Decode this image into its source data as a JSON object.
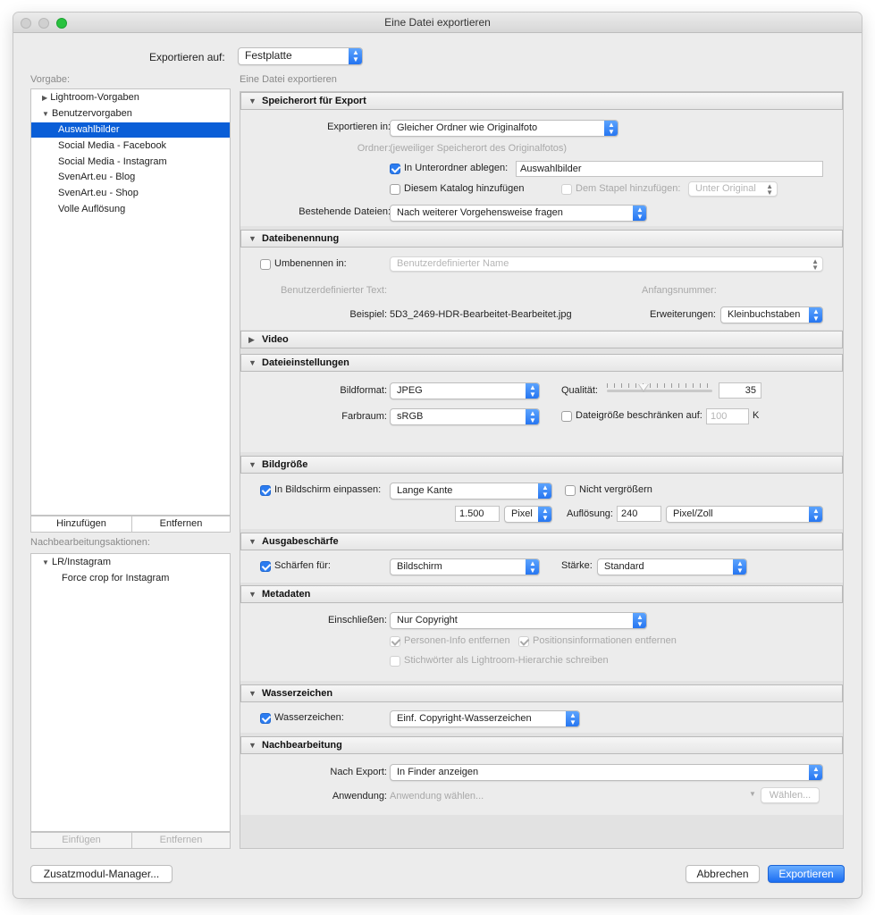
{
  "window": {
    "title": "Eine Datei exportieren"
  },
  "export_to": {
    "label": "Exportieren auf:",
    "value": "Festplatte"
  },
  "sidebar": {
    "presets_label": "Vorgabe:",
    "groups": [
      {
        "label": "Lightroom-Vorgaben",
        "expanded": false
      },
      {
        "label": "Benutzervorgaben",
        "expanded": true
      }
    ],
    "items": [
      "Auswahlbilder",
      "Social Media - Facebook",
      "Social Media - Instagram",
      "SvenArt.eu - Blog",
      "SvenArt.eu - Shop",
      "Volle Auflösung"
    ],
    "selected": "Auswahlbilder",
    "add_label": "Hinzufügen",
    "remove_label": "Entfernen",
    "post_actions_label": "Nachbearbeitungsaktionen:",
    "post_group": "LR/Instagram",
    "post_item": "Force crop for Instagram",
    "insert_label": "Einfügen",
    "remove2_label": "Entfernen"
  },
  "subtitle": "Eine Datei exportieren",
  "sections": {
    "location": {
      "title": "Speicherort für Export",
      "export_in_label": "Exportieren in:",
      "export_in_value": "Gleicher Ordner wie Originalfoto",
      "folder_label": "Ordner:",
      "folder_value": "(jeweiliger Speicherort des Originalfotos)",
      "subfolder_label": "In Unterordner ablegen:",
      "subfolder_value": "Auswahlbilder",
      "catalog_label": "Diesem Katalog hinzufügen",
      "stack_label": "Dem Stapel hinzufügen:",
      "stack_value": "Unter Original",
      "existing_label": "Bestehende Dateien:",
      "existing_value": "Nach weiterer Vorgehensweise fragen"
    },
    "naming": {
      "title": "Dateibenennung",
      "rename_label": "Umbenennen in:",
      "rename_value": "Benutzerdefinierter Name",
      "custom_text_label": "Benutzerdefinierter Text:",
      "start_number_label": "Anfangsnummer:",
      "example_label": "Beispiel:",
      "example_value": "5D3_2469-HDR-Bearbeitet-Bearbeitet.jpg",
      "extensions_label": "Erweiterungen:",
      "extensions_value": "Kleinbuchstaben"
    },
    "video": {
      "title": "Video"
    },
    "file_settings": {
      "title": "Dateieinstellungen",
      "format_label": "Bildformat:",
      "format_value": "JPEG",
      "quality_label": "Qualität:",
      "quality_value": "35",
      "quality_fraction": 0.35,
      "colorspace_label": "Farbraum:",
      "colorspace_value": "sRGB",
      "limit_label": "Dateigröße beschränken auf:",
      "limit_value": "100",
      "limit_unit": "K"
    },
    "image_size": {
      "title": "Bildgröße",
      "fit_label": "In Bildschirm einpassen:",
      "fit_value": "Lange Kante",
      "no_enlarge_label": "Nicht vergrößern",
      "size_value": "1.500",
      "size_unit": "Pixel",
      "resolution_label": "Auflösung:",
      "resolution_value": "240",
      "resolution_unit": "Pixel/Zoll"
    },
    "sharpening": {
      "title": "Ausgabeschärfe",
      "sharpen_label": "Schärfen für:",
      "sharpen_value": "Bildschirm",
      "amount_label": "Stärke:",
      "amount_value": "Standard"
    },
    "metadata": {
      "title": "Metadaten",
      "include_label": "Einschließen:",
      "include_value": "Nur Copyright",
      "person_label": "Personen-Info entfernen",
      "location_label": "Positionsinformationen entfernen",
      "keywords_label": "Stichwörter als Lightroom-Hierarchie schreiben"
    },
    "watermark": {
      "title": "Wasserzeichen",
      "label": "Wasserzeichen:",
      "value": "Einf. Copyright-Wasserzeichen"
    },
    "post_processing": {
      "title": "Nachbearbeitung",
      "after_label": "Nach Export:",
      "after_value": "In Finder anzeigen",
      "app_label": "Anwendung:",
      "app_placeholder": "Anwendung wählen...",
      "choose_label": "Wählen..."
    }
  },
  "footer": {
    "plugin_manager": "Zusatzmodul-Manager...",
    "cancel": "Abbrechen",
    "export": "Exportieren"
  }
}
